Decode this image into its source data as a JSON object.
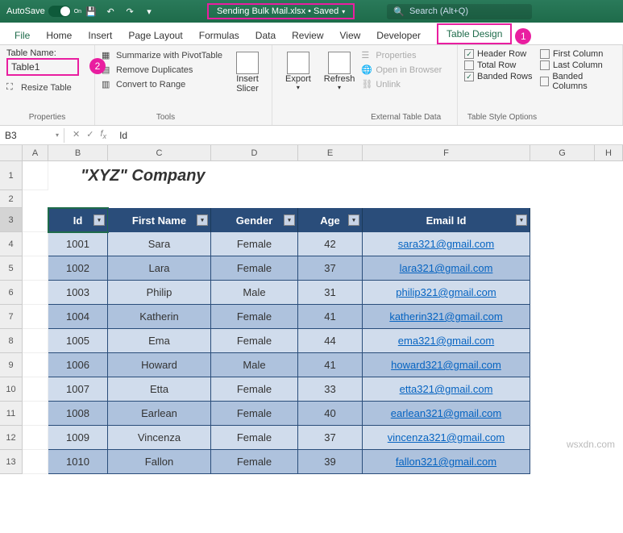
{
  "titlebar": {
    "autosave": "AutoSave",
    "autosave_state": "On",
    "filename": "Sending Bulk Mail.xlsx • Saved",
    "search_placeholder": "Search (Alt+Q)"
  },
  "tabs": [
    "File",
    "Home",
    "Insert",
    "Page Layout",
    "Formulas",
    "Data",
    "Review",
    "View",
    "Developer",
    "Table Design"
  ],
  "callout1": "1",
  "callout2": "2",
  "ribbon": {
    "properties": {
      "label": "Properties",
      "tablename_label": "Table Name:",
      "tablename_value": "Table1",
      "resize": "Resize Table"
    },
    "tools": {
      "label": "Tools",
      "pivot": "Summarize with PivotTable",
      "dup": "Remove Duplicates",
      "range": "Convert to Range",
      "slicer": "Insert\nSlicer"
    },
    "external": {
      "label": "External Table Data",
      "export": "Export",
      "refresh": "Refresh",
      "props": "Properties",
      "browser": "Open in Browser",
      "unlink": "Unlink"
    },
    "styleopts": {
      "label": "Table Style Options",
      "header": "Header Row",
      "total": "Total Row",
      "banded_rows": "Banded Rows",
      "first_col": "First Column",
      "last_col": "Last Column",
      "banded_cols": "Banded Columns"
    }
  },
  "namebox": "B3",
  "formula": "Id",
  "company": "\"XYZ\" Company",
  "cols": [
    "A",
    "B",
    "C",
    "D",
    "E",
    "F",
    "G",
    "H"
  ],
  "rows": [
    "1",
    "2",
    "3",
    "4",
    "5",
    "6",
    "7",
    "8",
    "9",
    "10",
    "11",
    "12",
    "13"
  ],
  "headers": [
    "Id",
    "First Name",
    "Gender",
    "Age",
    "Email Id"
  ],
  "data": [
    {
      "id": "1001",
      "first": "Sara",
      "gender": "Female",
      "age": "42",
      "email": "sara321@gmail.com"
    },
    {
      "id": "1002",
      "first": "Lara",
      "gender": "Female",
      "age": "37",
      "email": "lara321@gmail.com"
    },
    {
      "id": "1003",
      "first": "Philip",
      "gender": "Male",
      "age": "31",
      "email": "philip321@gmail.com"
    },
    {
      "id": "1004",
      "first": "Katherin",
      "gender": "Female",
      "age": "41",
      "email": "katherin321@gmail.com"
    },
    {
      "id": "1005",
      "first": "Ema",
      "gender": "Female",
      "age": "44",
      "email": "ema321@gmail.com"
    },
    {
      "id": "1006",
      "first": "Howard",
      "gender": "Male",
      "age": "41",
      "email": "howard321@gmail.com"
    },
    {
      "id": "1007",
      "first": "Etta",
      "gender": "Female",
      "age": "33",
      "email": "etta321@gmail.com"
    },
    {
      "id": "1008",
      "first": "Earlean",
      "gender": "Female",
      "age": "40",
      "email": "earlean321@gmail.com"
    },
    {
      "id": "1009",
      "first": "Vincenza",
      "gender": "Female",
      "age": "37",
      "email": "vincenza321@gmail.com"
    },
    {
      "id": "1010",
      "first": "Fallon",
      "gender": "Female",
      "age": "39",
      "email": "fallon321@gmail.com"
    }
  ],
  "watermark": "wsxdn.com"
}
